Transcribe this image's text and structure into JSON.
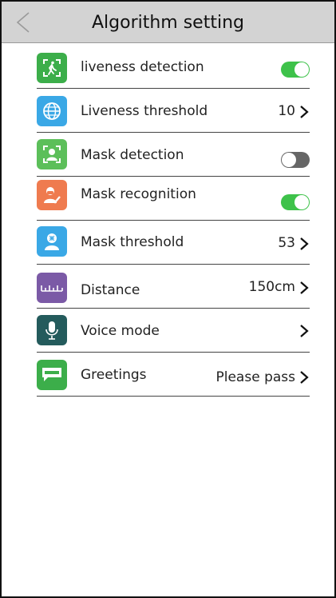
{
  "header": {
    "title": "Algorithm setting"
  },
  "colors": {
    "header_bg": "#d3d3d3",
    "toggle_on": "#3ec24a",
    "toggle_off": "#666666"
  },
  "settings": [
    {
      "label": "liveness detection",
      "icon": "walking-person-icon",
      "icon_color": "#3cae4a",
      "toggle": "on"
    },
    {
      "label": "Liveness threshold",
      "icon": "globe-icon",
      "icon_color": "#3aa8e6",
      "value": "10"
    },
    {
      "label": "Mask detection",
      "icon": "face-scan-icon",
      "icon_color": "#5cbf5a",
      "toggle": "off"
    },
    {
      "label": "Mask recognition",
      "icon": "masked-face-check-icon",
      "icon_color": "#ef7b4f",
      "toggle": "on"
    },
    {
      "label": "Mask threshold",
      "icon": "head-profile-icon",
      "icon_color": "#3aa8e6",
      "value": "53"
    },
    {
      "label": "Distance",
      "icon": "ruler-icon",
      "icon_color": "#7b5aa6",
      "value": "150cm"
    },
    {
      "label": "Voice mode",
      "icon": "microphone-icon",
      "icon_color": "#245b5c",
      "value": ""
    },
    {
      "label": "Greetings",
      "icon": "welcome-chat-icon",
      "icon_color": "#3cae4a",
      "value": "Please pass"
    }
  ]
}
